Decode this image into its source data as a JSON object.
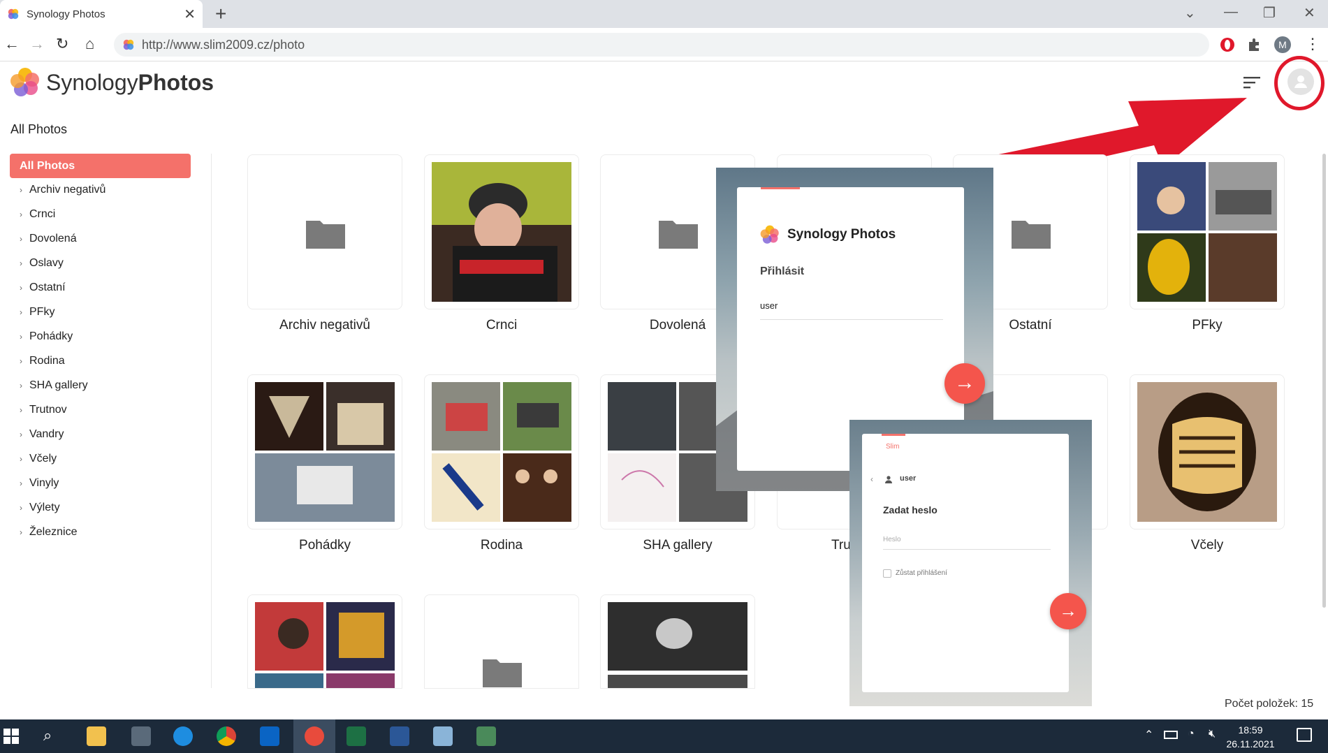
{
  "browser": {
    "tab_title": "Synology Photos",
    "url": "http://www.slim2009.cz/photo",
    "profile_initial": "M"
  },
  "app": {
    "brand_light": "Synology",
    "brand_bold": "Photos",
    "accent_color": "#f4716a"
  },
  "sidebar": {
    "title": "All Photos",
    "active": "All Photos",
    "items": [
      "Archiv negativů",
      "Crnci",
      "Dovolená",
      "Oslavy",
      "Ostatní",
      "PFky",
      "Pohádky",
      "Rodina",
      "SHA gallery",
      "Trutnov",
      "Vandry",
      "Včely",
      "Vinyly",
      "Výlety",
      "Železnice"
    ]
  },
  "grid": {
    "row1": [
      "Archiv negativů",
      "Crnci",
      "Dovolená",
      "Ostatní",
      "PFky"
    ],
    "row2": [
      "Pohádky",
      "Rodina",
      "SHA gallery",
      "Tru",
      "Včely"
    ]
  },
  "login1": {
    "title": "Synology Photos",
    "heading": "Přihlásit",
    "username": "user"
  },
  "login2": {
    "tag": "Slim",
    "user": "user",
    "heading": "Zadat heslo",
    "password_placeholder": "Heslo",
    "remember_label": "Zůstat přihlášení"
  },
  "footer": {
    "count": "Počet položek: 15"
  },
  "taskbar": {
    "time": "18:59",
    "date": "26.11.2021"
  }
}
